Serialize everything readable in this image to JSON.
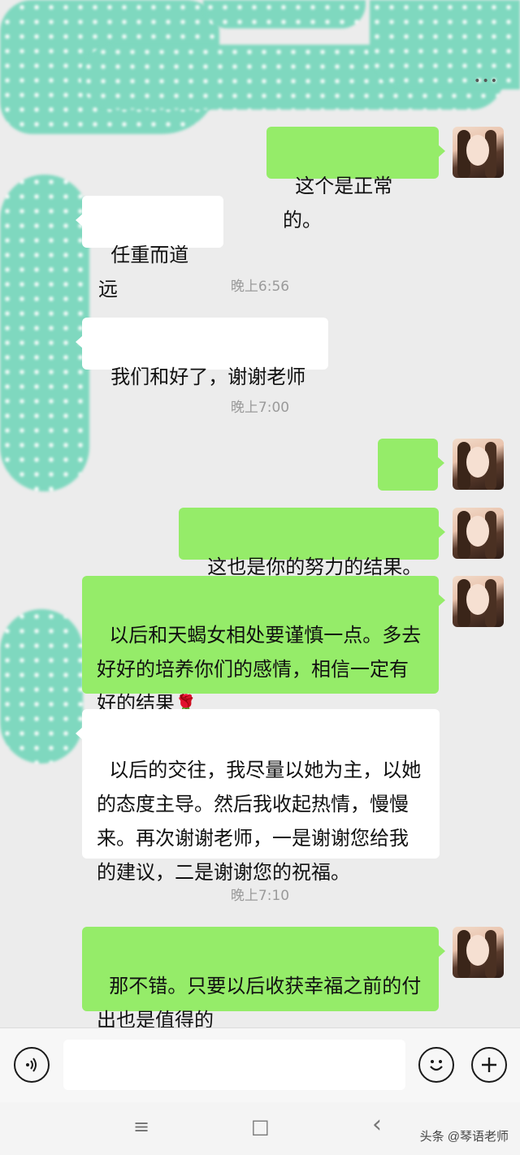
{
  "header": {
    "more_icon": "more-dots-icon",
    "more_label": "•••"
  },
  "messages": [
    {
      "side": "out",
      "text": "这个是正常的。"
    },
    {
      "side": "in",
      "text": "任重而道远"
    },
    {
      "type": "time",
      "text": "晚上6:56"
    },
    {
      "side": "in",
      "text": "我们和好了，谢谢老师"
    },
    {
      "type": "time",
      "text": "晚上7:00"
    },
    {
      "side": "out",
      "emoji": "🙏"
    },
    {
      "side": "out",
      "text": "这也是你的努力的结果。"
    },
    {
      "side": "out",
      "text": "以后和天蝎女相处要谨慎一点。多去好好的培养你们的感情，相信一定有好的结果",
      "emoji": "🌹"
    },
    {
      "side": "in",
      "text": "以后的交往，我尽量以她为主，以她的态度主导。然后我收起热情，慢慢来。再次谢谢老师，一是谢谢您给我的建议，二是谢谢您的祝福。"
    },
    {
      "type": "time",
      "text": "晚上7:10"
    },
    {
      "side": "out",
      "text": "那不错。只要以后收获幸福之前的付出也是值得的"
    }
  ],
  "input_bar": {
    "voice_icon": "voice-icon",
    "emoji_icon": "emoji-icon",
    "plus_icon": "plus-icon",
    "input_value": ""
  },
  "nav": {
    "menu": "≡",
    "home": "□",
    "back": "‹"
  },
  "watermark": "头条 @琴语老师",
  "colors": {
    "outgoing": "#95ec69",
    "incoming": "#ffffff",
    "background": "#ececec",
    "mosaic": "#7fd8bf"
  }
}
